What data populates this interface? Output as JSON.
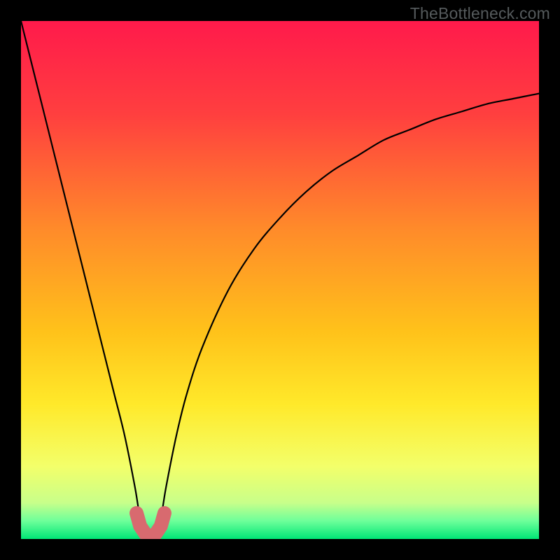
{
  "watermark": "TheBottleneck.com",
  "chart_data": {
    "type": "line",
    "title": "",
    "xlabel": "",
    "ylabel": "",
    "xlim": [
      0,
      100
    ],
    "ylim": [
      0,
      100
    ],
    "series": [
      {
        "name": "bottleneck-curve",
        "x": [
          0,
          2,
          4,
          6,
          8,
          10,
          12,
          14,
          16,
          18,
          20,
          22,
          23,
          24,
          25,
          26,
          27,
          28,
          30,
          32,
          35,
          40,
          45,
          50,
          55,
          60,
          65,
          70,
          75,
          80,
          85,
          90,
          95,
          100
        ],
        "y": [
          100,
          92,
          84,
          76,
          68,
          60,
          52,
          44,
          36,
          28,
          20,
          10,
          4,
          1,
          0,
          1,
          4,
          10,
          20,
          28,
          37,
          48,
          56,
          62,
          67,
          71,
          74,
          77,
          79,
          81,
          82.5,
          84,
          85,
          86
        ]
      }
    ],
    "marker": {
      "name": "optimal-region",
      "x": [
        22.3,
        23.0,
        24.0,
        25.0,
        26.0,
        27.0,
        27.7
      ],
      "y": [
        5.0,
        2.5,
        1.0,
        0.5,
        1.0,
        2.5,
        5.0
      ],
      "color": "#d86a6f"
    },
    "gradient": {
      "stops": [
        {
          "offset": 0.0,
          "color": "#ff1a4b"
        },
        {
          "offset": 0.18,
          "color": "#ff3f3f"
        },
        {
          "offset": 0.4,
          "color": "#ff8a2a"
        },
        {
          "offset": 0.6,
          "color": "#ffc21a"
        },
        {
          "offset": 0.74,
          "color": "#ffe92a"
        },
        {
          "offset": 0.86,
          "color": "#f3ff6a"
        },
        {
          "offset": 0.93,
          "color": "#c8ff8a"
        },
        {
          "offset": 0.965,
          "color": "#6eff9a"
        },
        {
          "offset": 1.0,
          "color": "#00e676"
        }
      ]
    }
  }
}
